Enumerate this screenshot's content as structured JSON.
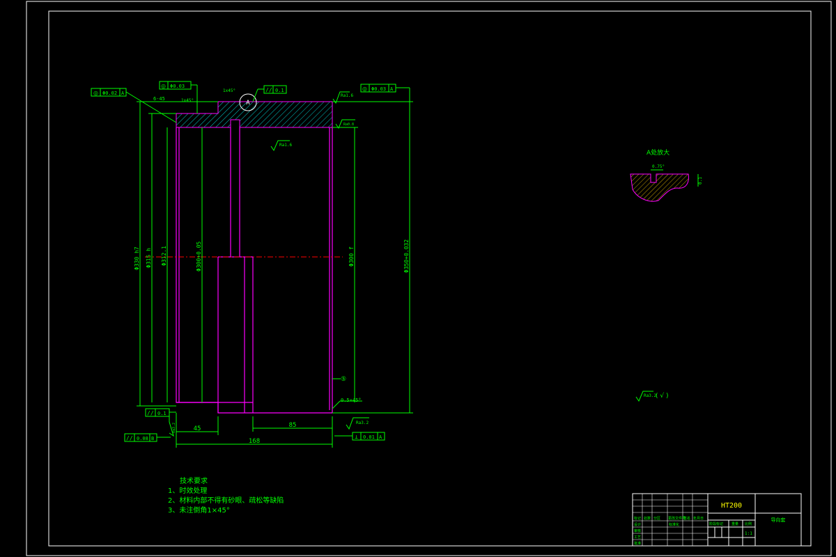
{
  "drawing": {
    "material": "HT200",
    "part_name": "导向套",
    "detail_title": "A处放大",
    "detail_angle": "0.75°",
    "detail_dim": "0.1",
    "general_roughness": "Ra3.2",
    "general_roughness_suffix": "( √ )",
    "tech_requirements": {
      "title": "技术要求",
      "items": [
        "1、时效处理",
        "2、材料内部不得有砂眼、疏松等缺陷",
        "3、未注倒角1×45°"
      ]
    },
    "dimensions": {
      "overall_length": "168",
      "left_step": "45",
      "right_step": "85",
      "chamfer_top": "6-45",
      "chamfer_left": "1x45°",
      "chamfer_top2": "1x45°",
      "chamfer_bottom": "0.5×45°",
      "dia_outer_left": "Φ330 h7",
      "dia_left2": "Φ315 h",
      "dia_left3": "Φ312.1",
      "dia_bore": "Φ300+0.05",
      "dia_right": "Φ300 f",
      "dia_outer_right": "Φ350+0.032",
      "ra_top": "Ra1.6",
      "ra_mid": "Ra1.6",
      "ra_right_top": "Ra0.8",
      "ra_bottom": "Ra3.2",
      "ra_left_bottom": "Ra3.2",
      "balloon": "A",
      "ref_mark": "⑤"
    },
    "tolerances": {
      "fcf_top_left": [
        "◎",
        "Φ0.02",
        "A"
      ],
      "fcf_top_mid": [
        "◎",
        "Φ0.03",
        ""
      ],
      "fcf_parallel_top": [
        "//",
        "0.1",
        ""
      ],
      "fcf_top_right": [
        "◎",
        "Φ0.03",
        "A"
      ],
      "fcf_parallel_left": [
        "//",
        "0.1",
        ""
      ],
      "fcf_parallel_bottom": [
        "//",
        "0.08",
        "B"
      ],
      "fcf_perp_bottom": [
        "⊥",
        "0.01",
        "A"
      ]
    },
    "title_block": {
      "rows": [
        "标记",
        "设计",
        "审核",
        "工艺",
        "批准"
      ],
      "cols": [
        "处数",
        "分区",
        "更改文件号",
        "签名",
        "年月日"
      ],
      "stage_labels": [
        "阶段标记",
        "重量",
        "比例"
      ],
      "scale": "1:1",
      "standard": "标准化"
    }
  }
}
